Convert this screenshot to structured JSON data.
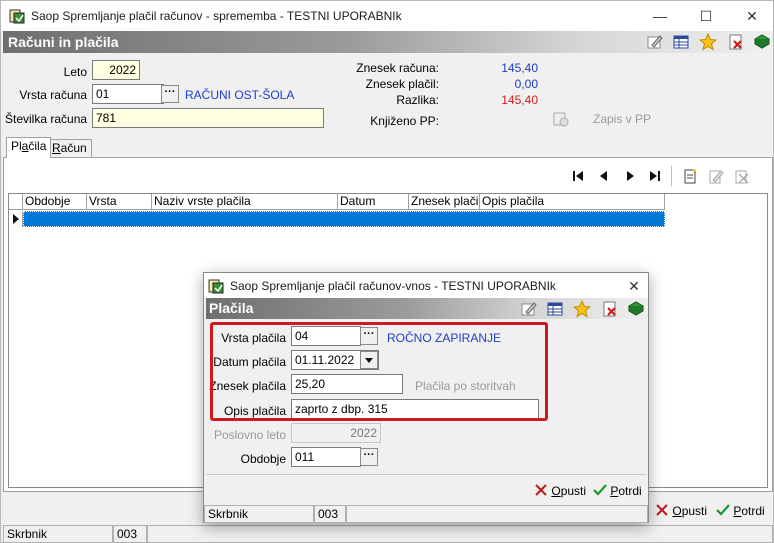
{
  "main_window": {
    "title": "Saop Spremljanje plačil računov - sprememba - TESTNI UPORABNIk",
    "section_title": "Računi in plačila",
    "fields": {
      "leto_label": "Leto",
      "leto_value": "2022",
      "vrsta_racuna_label": "Vrsta računa",
      "vrsta_racuna_value": "01",
      "vrsta_racuna_desc": "RAČUNI OST-ŠOLA",
      "stevilka_racuna_label": "Številka računa",
      "stevilka_racuna_value": "781"
    },
    "summary": {
      "znesek_racuna_label": "Znesek računa:",
      "znesek_racuna_value": "145,40",
      "znesek_placil_label": "Znesek plačil:",
      "znesek_placil_value": "0,00",
      "razlika_label": "Razlika:",
      "razlika_value": "145,40",
      "knjizeno_label": "Knjiženo PP:",
      "zapis_label": "Zapis v PP"
    },
    "tabs": [
      {
        "label_pre": "Pl",
        "label_u": "a",
        "label_post": "čila"
      },
      {
        "label_pre": "",
        "label_u": "R",
        "label_post": "ačun"
      }
    ],
    "grid_columns": [
      "Obdobje",
      "Vrsta",
      "Naziv vrste plačila",
      "Datum",
      "Znesek plačila",
      "Opis plačila"
    ],
    "status": [
      "Skrbnik",
      "003",
      ""
    ],
    "buttons": {
      "opusti_u": "O",
      "opusti_rest": "pusti",
      "potrdi_u": "P",
      "potrdi_rest": "otrdi"
    }
  },
  "dialog": {
    "title": "Saop Spremljanje plačil računov-vnos - TESTNI UPORABNIk",
    "section_title": "Plačila",
    "fields": {
      "vrsta_placila_label": "Vrsta plačila",
      "vrsta_placila_value": "04",
      "vrsta_placila_desc": "ROČNO ZAPIRANJE",
      "datum_placila_label": "Datum plačila",
      "datum_placila_value": "01.11.2022",
      "znesek_placila_label": "Znesek plačila",
      "znesek_placila_value": "25,20",
      "placila_po_storitvah": "Plačila po storitvah",
      "opis_placila_label": "Opis plačila",
      "opis_placila_value": "zaprto z dbp. 315",
      "poslovno_leto_label": "Poslovno leto",
      "poslovno_leto_value": "2022",
      "obdobje_label": "Obdobje",
      "obdobje_value": "011"
    },
    "status": [
      "Skrbnik",
      "003",
      ""
    ],
    "buttons": {
      "opusti_u": "O",
      "opusti_rest": "pusti",
      "potrdi_u": "P",
      "potrdi_rest": "otrdi"
    }
  },
  "colors": {
    "highlight_row": "#0078d7",
    "accent_blue": "#1e3ec9",
    "red_value": "#d81c1c",
    "red_box": "#d0181e",
    "field_yellow": "#ffffe1"
  },
  "icons": [
    "app-icon",
    "edit-icon",
    "table-icon",
    "star-icon",
    "delete-icon",
    "book-icon",
    "first-icon",
    "prev-icon",
    "next-icon",
    "last-icon",
    "new-icon",
    "edit-row-icon",
    "delete-row-icon",
    "cancel-icon",
    "confirm-icon",
    "knjizeno-icon"
  ]
}
